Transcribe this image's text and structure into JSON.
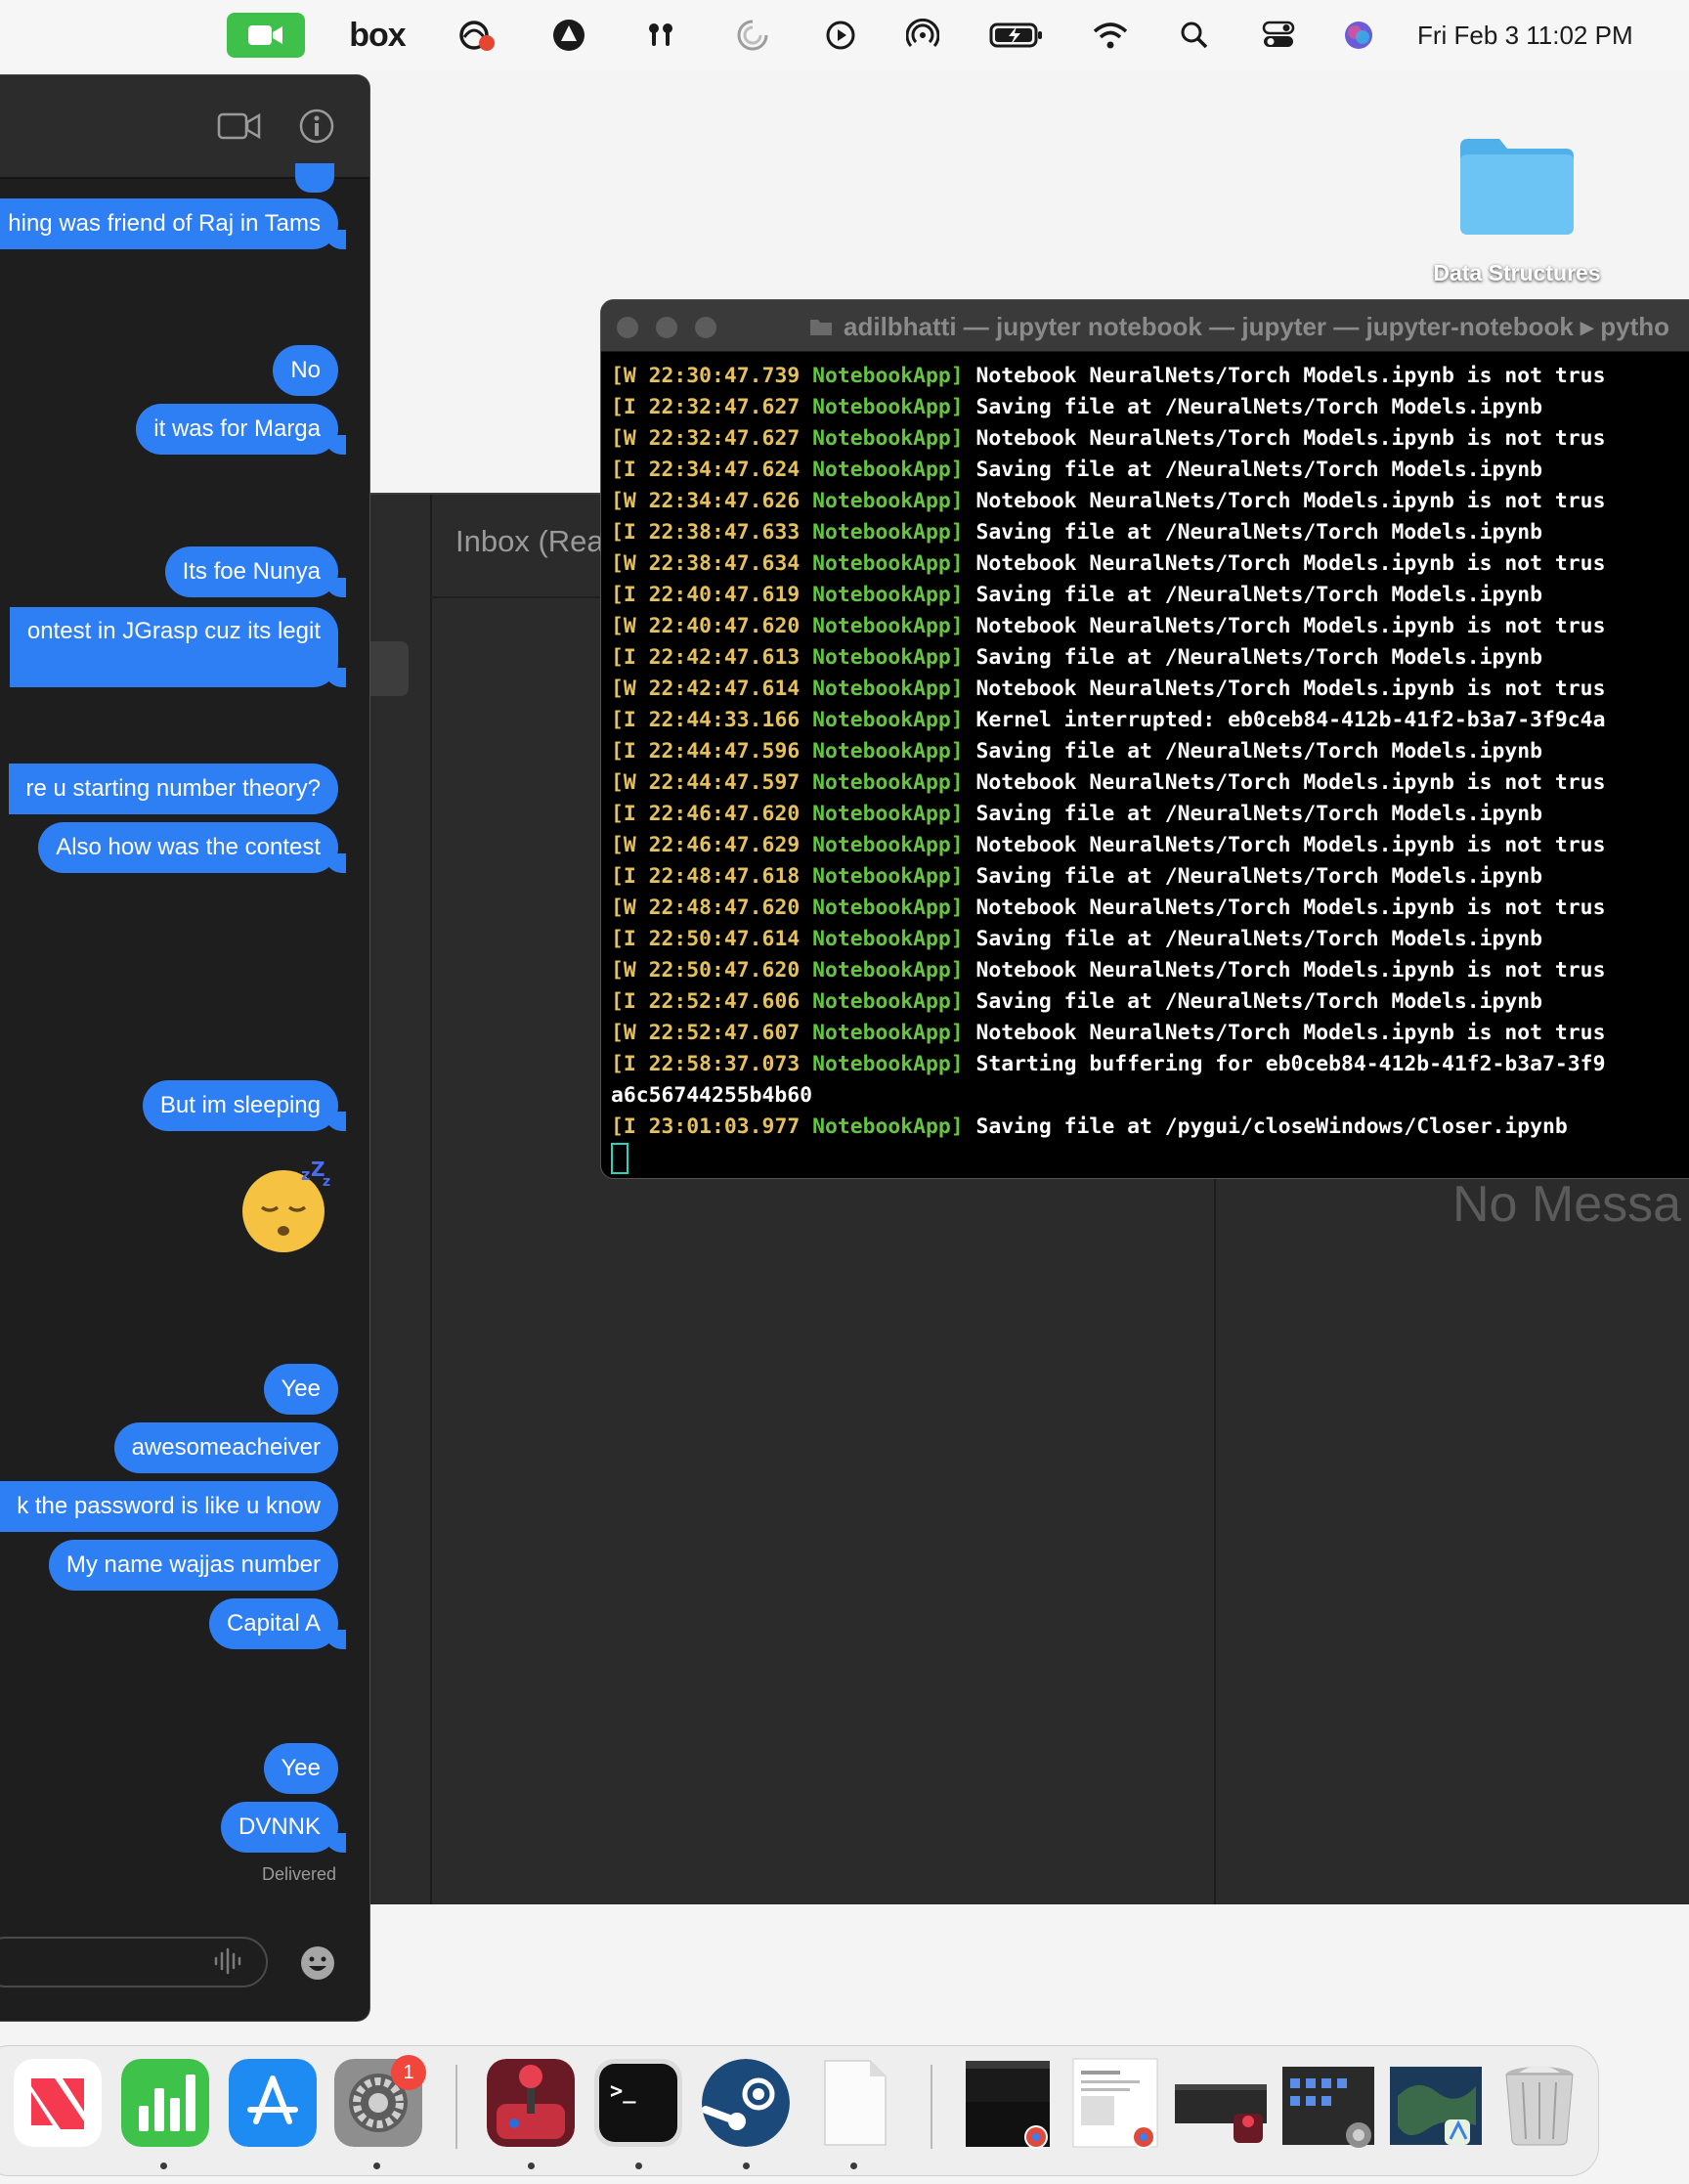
{
  "menubar": {
    "facetime_icon": "video-camera-icon",
    "box_label": "box",
    "status_icons": [
      "cloud-sync-icon",
      "sketch-icon",
      "airpods-icon",
      "spinner-icon",
      "play-icon",
      "airdrop-icon",
      "battery-charging-icon",
      "wifi-icon",
      "search-icon",
      "control-center-icon",
      "siri-icon"
    ],
    "clock": "Fri Feb 3  11:02 PM"
  },
  "desktop": {
    "folder_label": "Data Structures"
  },
  "mail": {
    "mailbox_title": "Inbox (Rea",
    "empty_state": "No Messa"
  },
  "messages": {
    "bubbles": [
      {
        "text": "hing was friend of Raj in Tams"
      },
      {
        "text": "No"
      },
      {
        "text": "it was for Marga"
      },
      {
        "text": "Its foe Nunya"
      },
      {
        "text": "ontest in JGrasp cuz its legit"
      },
      {
        "text": "re u starting number theory?"
      },
      {
        "text": "Also how was the contest"
      },
      {
        "text": "But im sleeping"
      },
      {
        "text": "Yee"
      },
      {
        "text": "awesomeacheiver"
      },
      {
        "text": "k the password is like u know"
      },
      {
        "text": "My name wajjas number"
      },
      {
        "text": "Capital A"
      },
      {
        "text": "Yee"
      },
      {
        "text": "DVNNK"
      }
    ],
    "delivered": "Delivered",
    "sleep_emoji": "😴"
  },
  "terminal": {
    "title": "adilbhatti — jupyter notebook — jupyter — jupyter-notebook ▸ pytho",
    "lines": [
      {
        "lvl": "[W",
        "ts": "22:30:47.739",
        "app": "NotebookApp]",
        "msg": "Notebook NeuralNets/Torch Models.ipynb is not trus"
      },
      {
        "lvl": "[I",
        "ts": "22:32:47.627",
        "app": "NotebookApp]",
        "msg": "Saving file at /NeuralNets/Torch Models.ipynb"
      },
      {
        "lvl": "[W",
        "ts": "22:32:47.627",
        "app": "NotebookApp]",
        "msg": "Notebook NeuralNets/Torch Models.ipynb is not trus"
      },
      {
        "lvl": "[I",
        "ts": "22:34:47.624",
        "app": "NotebookApp]",
        "msg": "Saving file at /NeuralNets/Torch Models.ipynb"
      },
      {
        "lvl": "[W",
        "ts": "22:34:47.626",
        "app": "NotebookApp]",
        "msg": "Notebook NeuralNets/Torch Models.ipynb is not trus"
      },
      {
        "lvl": "[I",
        "ts": "22:38:47.633",
        "app": "NotebookApp]",
        "msg": "Saving file at /NeuralNets/Torch Models.ipynb"
      },
      {
        "lvl": "[W",
        "ts": "22:38:47.634",
        "app": "NotebookApp]",
        "msg": "Notebook NeuralNets/Torch Models.ipynb is not trus"
      },
      {
        "lvl": "[I",
        "ts": "22:40:47.619",
        "app": "NotebookApp]",
        "msg": "Saving file at /NeuralNets/Torch Models.ipynb"
      },
      {
        "lvl": "[W",
        "ts": "22:40:47.620",
        "app": "NotebookApp]",
        "msg": "Notebook NeuralNets/Torch Models.ipynb is not trus"
      },
      {
        "lvl": "[I",
        "ts": "22:42:47.613",
        "app": "NotebookApp]",
        "msg": "Saving file at /NeuralNets/Torch Models.ipynb"
      },
      {
        "lvl": "[W",
        "ts": "22:42:47.614",
        "app": "NotebookApp]",
        "msg": "Notebook NeuralNets/Torch Models.ipynb is not trus"
      },
      {
        "lvl": "[I",
        "ts": "22:44:33.166",
        "app": "NotebookApp]",
        "msg": "Kernel interrupted: eb0ceb84-412b-41f2-b3a7-3f9c4a"
      },
      {
        "lvl": "[I",
        "ts": "22:44:47.596",
        "app": "NotebookApp]",
        "msg": "Saving file at /NeuralNets/Torch Models.ipynb"
      },
      {
        "lvl": "[W",
        "ts": "22:44:47.597",
        "app": "NotebookApp]",
        "msg": "Notebook NeuralNets/Torch Models.ipynb is not trus"
      },
      {
        "lvl": "[I",
        "ts": "22:46:47.620",
        "app": "NotebookApp]",
        "msg": "Saving file at /NeuralNets/Torch Models.ipynb"
      },
      {
        "lvl": "[W",
        "ts": "22:46:47.629",
        "app": "NotebookApp]",
        "msg": "Notebook NeuralNets/Torch Models.ipynb is not trus"
      },
      {
        "lvl": "[I",
        "ts": "22:48:47.618",
        "app": "NotebookApp]",
        "msg": "Saving file at /NeuralNets/Torch Models.ipynb"
      },
      {
        "lvl": "[W",
        "ts": "22:48:47.620",
        "app": "NotebookApp]",
        "msg": "Notebook NeuralNets/Torch Models.ipynb is not trus"
      },
      {
        "lvl": "[I",
        "ts": "22:50:47.614",
        "app": "NotebookApp]",
        "msg": "Saving file at /NeuralNets/Torch Models.ipynb"
      },
      {
        "lvl": "[W",
        "ts": "22:50:47.620",
        "app": "NotebookApp]",
        "msg": "Notebook NeuralNets/Torch Models.ipynb is not trus"
      },
      {
        "lvl": "[I",
        "ts": "22:52:47.606",
        "app": "NotebookApp]",
        "msg": "Saving file at /NeuralNets/Torch Models.ipynb"
      },
      {
        "lvl": "[W",
        "ts": "22:52:47.607",
        "app": "NotebookApp]",
        "msg": "Notebook NeuralNets/Torch Models.ipynb is not trus"
      },
      {
        "lvl": "[I",
        "ts": "22:58:37.073",
        "app": "NotebookApp]",
        "msg": "Starting buffering for eb0ceb84-412b-41f2-b3a7-3f9"
      }
    ],
    "wrap_line": "a6c56744255b4b60",
    "last_line": {
      "lvl": "[I",
      "ts": "23:01:03.977",
      "app": "NotebookApp]",
      "msg": "Saving file at /pygui/closeWindows/Closer.ipynb"
    }
  },
  "dock": {
    "apps": [
      "news-icon",
      "numbers-icon",
      "app-store-icon",
      "system-preferences-icon",
      "joystick-app-icon",
      "terminal-icon",
      "steam-icon",
      "document-icon"
    ],
    "badge_count": "1",
    "windows": [
      "chrome-window-thumbnail",
      "chrome-window-thumbnail",
      "app-window-thumbnail",
      "system-preferences-window-thumbnail",
      "maps-window-thumbnail"
    ],
    "trash": "trash-icon"
  },
  "colors": {
    "imessage_blue": "#2f7ff4",
    "terminal_yellow": "#e5c05b",
    "terminal_green": "#63c540",
    "facetime_green": "#3ec04a"
  }
}
